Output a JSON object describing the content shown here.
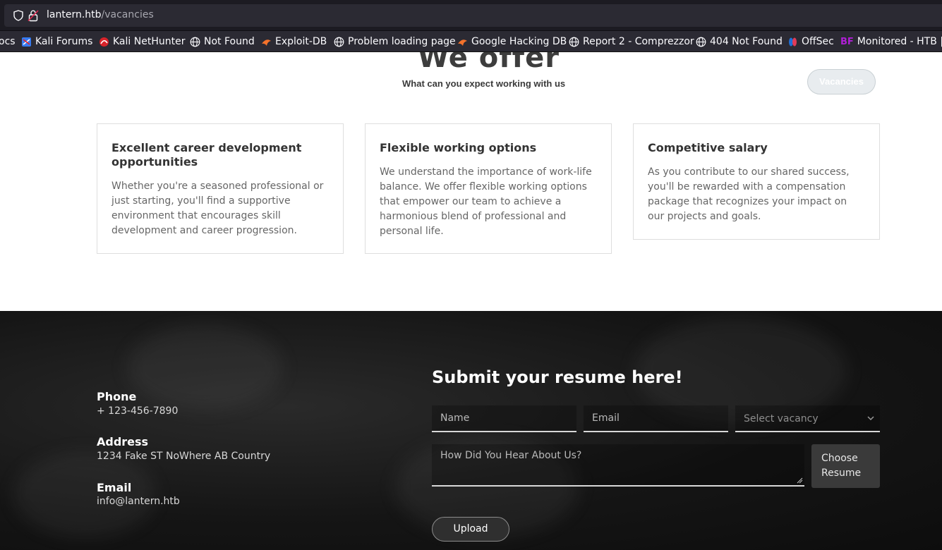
{
  "browser": {
    "url_host": "lantern.htb",
    "url_path": "/vacancies",
    "bookmarks": [
      {
        "label": "ocs",
        "icon": "none"
      },
      {
        "label": "Kali Forums",
        "icon": "kali-forums-icon"
      },
      {
        "label": "Kali NetHunter",
        "icon": "nethunter-icon"
      },
      {
        "label": "Not Found",
        "icon": "globe-icon"
      },
      {
        "label": "Exploit-DB",
        "icon": "exploitdb-icon"
      },
      {
        "label": "Problem loading page",
        "icon": "globe-icon"
      },
      {
        "label": "Google Hacking DB",
        "icon": "ghdb-icon"
      },
      {
        "label": "Report 2 - Comprezzor",
        "icon": "globe-icon"
      },
      {
        "label": "404 Not Found",
        "icon": "globe-icon"
      },
      {
        "label": "OffSec",
        "icon": "offsec-icon"
      },
      {
        "label": "Monitored - HTB | E",
        "icon": "bf-icon",
        "icon_text": "BF"
      }
    ]
  },
  "offer": {
    "title": "We offer",
    "subtitle": "What can you expect working with us",
    "vacancies_button": "Vacancies",
    "cards": [
      {
        "title": "Excellent career development opportunities",
        "text": "Whether you're a seasoned professional or just starting, you'll find a supportive environment that encourages skill development and career progression."
      },
      {
        "title": "Flexible working options",
        "text": "We understand the importance of work-life balance. We offer flexible working options that empower our team to achieve a harmonious blend of professional and personal life."
      },
      {
        "title": "Competitive salary",
        "text": "As you contribute to our shared success, you'll be rewarded with a compensation package that recognizes your impact on our projects and goals."
      }
    ]
  },
  "contact": {
    "phone_label": "Phone",
    "phone_value": "+ 123-456-7890",
    "address_label": "Address",
    "address_value": "1234 Fake ST NoWhere AB Country",
    "email_label": "Email",
    "email_value": "info@lantern.htb"
  },
  "resume_form": {
    "title": "Submit your resume here!",
    "name_placeholder": "Name",
    "email_placeholder": "Email",
    "vacancy_selected": "Select vacancy",
    "hear_placeholder": "How Did You Hear About Us?",
    "choose_button": "Choose Resume",
    "upload_button": "Upload"
  },
  "colors": {
    "footer_bg": "#151515",
    "accent_bf": "#b01fd6"
  }
}
